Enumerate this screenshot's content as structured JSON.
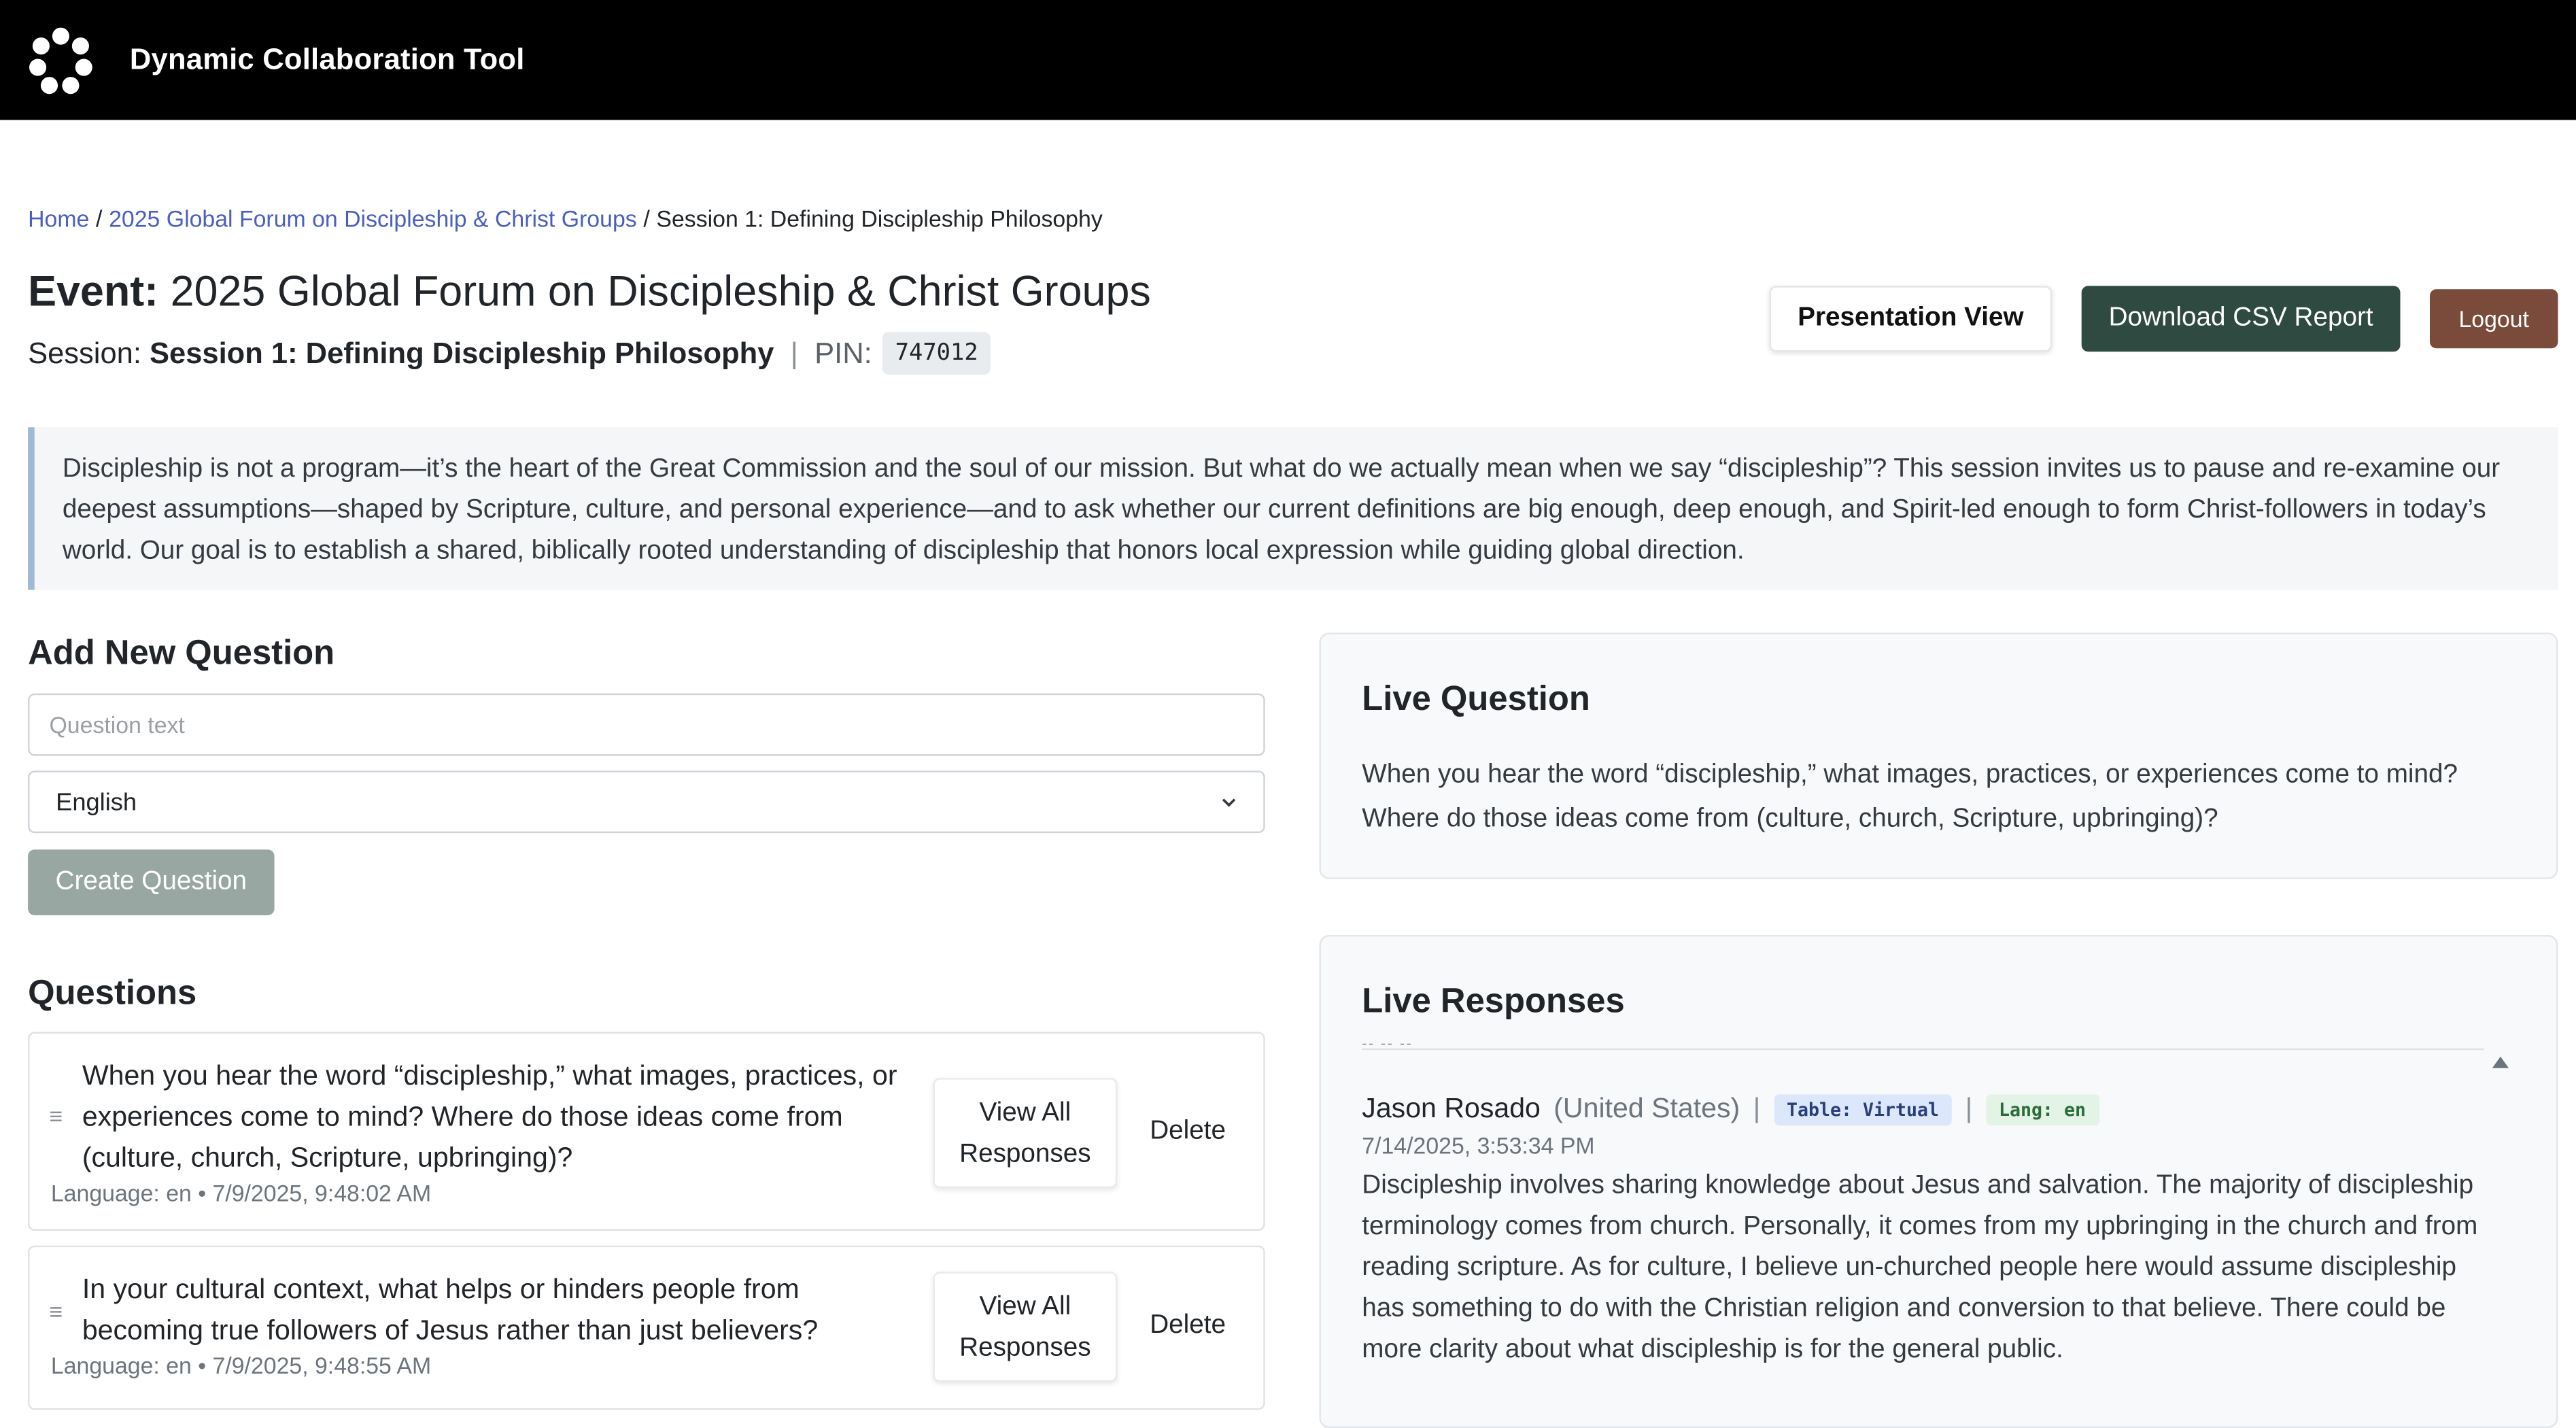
{
  "app": {
    "title": "Dynamic Collaboration Tool"
  },
  "breadcrumb": {
    "home": "Home",
    "separator": "/",
    "event": "2025 Global Forum on Discipleship & Christ Groups",
    "session": "Session 1: Defining Discipleship Philosophy"
  },
  "header": {
    "event_label": "Event:",
    "event_name": "2025 Global Forum on Discipleship & Christ Groups",
    "session_label": "Session:",
    "session_name": "Session 1: Defining Discipleship Philosophy",
    "divider": "|",
    "pin_label": "PIN:",
    "pin_value": "747012",
    "presentation_button": "Presentation View",
    "csv_button": "Download CSV Report",
    "logout_button": "Logout"
  },
  "description": "Discipleship is not a program—it’s the heart of the Great Commission and the soul of our mission. But what do we actually mean when we say “discipleship”? This session invites us to pause and re-examine our deepest assumptions—shaped by Scripture, culture, and personal experience—and to ask whether our current definitions are big enough, deep enough, and Spirit-led enough to form Christ-followers in today’s world. Our goal is to establish a shared, biblically rooted understanding of discipleship that honors local expression while guiding global direction.",
  "add_question": {
    "heading": "Add New Question",
    "input_placeholder": "Question text",
    "input_value": "",
    "language_selected": "English",
    "create_button": "Create Question"
  },
  "questions": {
    "heading": "Questions",
    "items": [
      {
        "text": "When you hear the word “discipleship,” what images, practices, or experiences come to mind? Where do those ideas come from (culture, church, Scripture, upbringing)?",
        "meta": "Language: en • 7/9/2025, 9:48:02 AM",
        "view_button": "View All Responses",
        "delete_button": "Delete"
      },
      {
        "text": "In your cultural context, what helps or hinders people from becoming true followers of Jesus rather than just believers?",
        "meta": "Language: en • 7/9/2025, 9:48:55 AM",
        "view_button": "View All Responses",
        "delete_button": "Delete"
      }
    ]
  },
  "live_question": {
    "heading": "Live Question",
    "text": "When you hear the word “discipleship,” what images, practices, or experiences come to mind? Where do those ideas come from (culture, church, Scripture, upbringing)?"
  },
  "live_responses": {
    "heading": "Live Responses",
    "dash_text": "-- -- --",
    "items": [
      {
        "name": "Jason Rosado",
        "country": "(United States)",
        "pipe": "|",
        "table_tag": "Table: Virtual",
        "lang_tag": "Lang: en",
        "timestamp": "7/14/2025, 3:53:34 PM",
        "body": "Discipleship involves sharing knowledge about Jesus and salvation. The majority of discipleship terminology comes from church. Personally, it comes from my upbringing in the church and from reading scripture. As for culture, I believe un-churched people here would assume discipleship has something to do with the Christian religion and conversion to that believe. There could be more clarity about what discipleship is for the general public."
      }
    ]
  },
  "icons": {
    "logo": "flower-logo-icon",
    "drag": "drag-handle-icon",
    "select_chevron": "chevron-down-icon",
    "scroll_up": "scroll-up-arrow-icon"
  },
  "colors": {
    "topbar": "#000000",
    "link": "#4a5fc1",
    "csv_button": "#2f4a41",
    "logout_button": "#7a4a3a",
    "create_button": "#98a7a1",
    "description_border": "#9fb9d6"
  }
}
